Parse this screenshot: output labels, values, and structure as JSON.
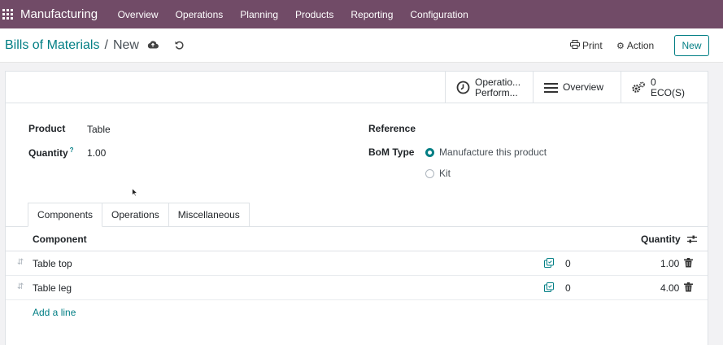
{
  "navbar": {
    "app_name": "Manufacturing",
    "menu": [
      "Overview",
      "Operations",
      "Planning",
      "Products",
      "Reporting",
      "Configuration"
    ]
  },
  "breadcrumb": {
    "parent": "Bills of Materials",
    "separator": "/",
    "current": "New"
  },
  "toolbar": {
    "print_label": "Print",
    "action_label": "Action",
    "new_label": "New"
  },
  "stat_buttons": {
    "operations_line1": "Operatio...",
    "operations_line2": "Perform...",
    "overview_label": "Overview",
    "eco_count": "0",
    "eco_label": "ECO(S)"
  },
  "form": {
    "product_label": "Product",
    "product_value": "Table",
    "quantity_label": "Quantity",
    "quantity_help": "?",
    "quantity_value": "1.00",
    "reference_label": "Reference",
    "bom_type_label": "BoM Type",
    "bom_type_options": [
      {
        "label": "Manufacture this product",
        "checked": true
      },
      {
        "label": "Kit",
        "checked": false
      }
    ]
  },
  "tabs": [
    "Components",
    "Operations",
    "Miscellaneous"
  ],
  "components_table": {
    "col_component": "Component",
    "col_quantity": "Quantity",
    "rows": [
      {
        "component": "Table top",
        "on_hand": "0",
        "quantity": "1.00"
      },
      {
        "component": "Table leg",
        "on_hand": "0",
        "quantity": "4.00"
      }
    ],
    "add_line": "Add a line"
  },
  "colors": {
    "navbar": "#714b67",
    "accent": "#017e84"
  }
}
